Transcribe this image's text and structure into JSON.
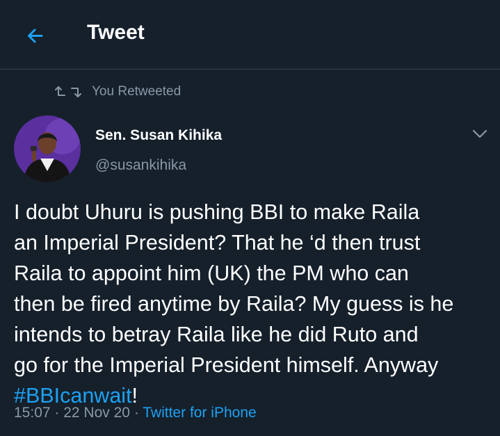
{
  "header": {
    "back_icon": "arrow-left-icon",
    "title": "Tweet"
  },
  "retweet": {
    "icon": "retweet-icon",
    "label": "You Retweeted"
  },
  "author": {
    "name": "Sen. Susan Kihika",
    "handle": "@susankihika"
  },
  "tweet": {
    "text": "I doubt Uhuru is pushing BBI to make Raila\nan Imperial President? That he ‘d then trust\nRaila to appoint him (UK) the PM who can\nthen be fired anytime by Raila? My guess is he\nintends to betray Raila like he did Ruto and\ngo for the Imperial President himself. Anyway\n",
    "hashtag": "#BBIcanwait",
    "tail": "!"
  },
  "meta": {
    "time": "15:07",
    "date": "22 Nov 20",
    "source": "Twitter for iPhone"
  },
  "colors": {
    "background": "#15202b",
    "accent": "#1da1f2",
    "secondary_text": "#8899a6",
    "divider": "#38444d"
  }
}
